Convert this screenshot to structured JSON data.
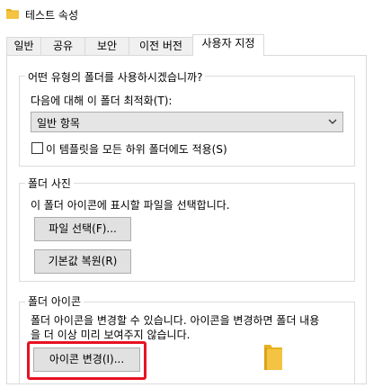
{
  "window": {
    "title": "테스트 속성"
  },
  "tabs": [
    {
      "label": "일반"
    },
    {
      "label": "공유"
    },
    {
      "label": "보안"
    },
    {
      "label": "이전 버전"
    },
    {
      "label": "사용자 지정"
    }
  ],
  "optimize_group": {
    "legend": "어떤 유형의 폴더를 사용하시겠습니까?",
    "optimize_label": "다음에 대해 이 폴더 최적화(T):",
    "optimize_value": "일반 항목",
    "apply_template_label": "이 템플릿을 모든 하위 폴더에도 적용(S)",
    "apply_template_checked": false
  },
  "picture_group": {
    "legend": "폴더 사진",
    "description": "이 폴더 아이콘에 표시할 파일을 선택합니다.",
    "choose_file_label": "파일 선택(F)...",
    "restore_default_label": "기본값 복원(R)"
  },
  "icon_group": {
    "legend": "폴더 아이콘",
    "description_line1": "폴더 아이콘을 변경할 수 있습니다. 아이콘을 변경하면 폴더 내용",
    "description_line2": "을 더 이상 미리 보여주지 않습니다.",
    "change_icon_label": "아이콘 변경(I)..."
  },
  "colors": {
    "highlight": "#e81123",
    "folder": "#f5c342"
  }
}
